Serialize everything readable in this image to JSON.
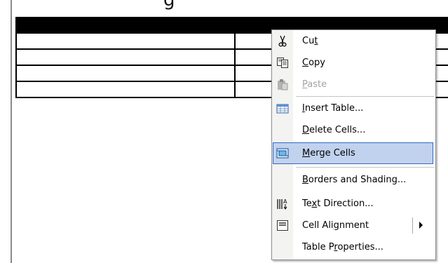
{
  "document": {
    "top_glyph": "g"
  },
  "context_menu": {
    "items": [
      {
        "name": "cut",
        "pre": "Cu",
        "accel": "t",
        "post": "",
        "icon": "scissors-icon",
        "disabled": false
      },
      {
        "name": "copy",
        "pre": "",
        "accel": "C",
        "post": "opy",
        "icon": "copy-icon",
        "disabled": false
      },
      {
        "name": "paste",
        "pre": "",
        "accel": "P",
        "post": "aste",
        "icon": "paste-icon",
        "disabled": true
      },
      {
        "name": "insert-table",
        "pre": "",
        "accel": "I",
        "post": "nsert Table...",
        "icon": "table-icon",
        "disabled": false
      },
      {
        "name": "delete-cells",
        "pre": "",
        "accel": "D",
        "post": "elete Cells...",
        "icon": "",
        "disabled": false
      },
      {
        "name": "merge-cells",
        "pre": "",
        "accel": "M",
        "post": "erge Cells",
        "icon": "merge-cells-icon",
        "disabled": false,
        "selected": true
      },
      {
        "name": "borders-and-shading",
        "pre": "",
        "accel": "B",
        "post": "orders and Shading...",
        "icon": "",
        "disabled": false
      },
      {
        "name": "text-direction",
        "pre": "Te",
        "accel": "x",
        "post": "t Direction...",
        "icon": "text-direction-icon",
        "disabled": false
      },
      {
        "name": "cell-alignment",
        "pre": "Cell Ali",
        "accel": "g",
        "post": "nment",
        "icon": "cell-alignment-icon",
        "disabled": false,
        "submenu": true
      },
      {
        "name": "table-properties",
        "pre": "Table P",
        "accel": "r",
        "post": "operties...",
        "icon": "",
        "disabled": false
      }
    ]
  },
  "colors": {
    "highlight_fill": "#c1d2ee",
    "highlight_border": "#316ac5",
    "disabled_text": "#a3a3a3",
    "gutter": "#f3f3f1"
  }
}
